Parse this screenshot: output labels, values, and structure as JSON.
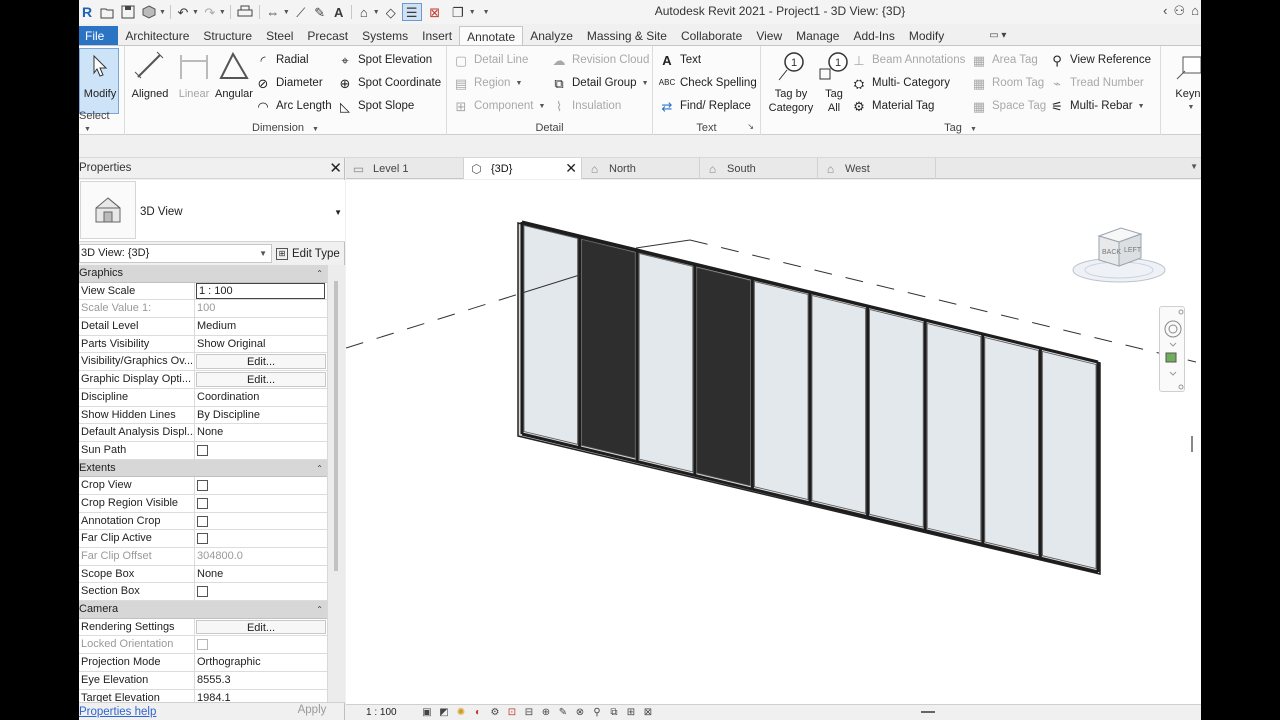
{
  "window": {
    "title": "Autodesk Revit 2021 - Project1 - 3D View: {3D}"
  },
  "menu": {
    "file": "File",
    "tabs": [
      "Architecture",
      "Structure",
      "Steel",
      "Precast",
      "Systems",
      "Insert",
      "Annotate",
      "Analyze",
      "Massing & Site",
      "Collaborate",
      "View",
      "Manage",
      "Add-Ins",
      "Modify"
    ],
    "active_tab": "Annotate"
  },
  "ribbon": {
    "select": {
      "modify": "Modify",
      "label": "Select"
    },
    "dimension": {
      "label": "Dimension",
      "aligned": "Aligned",
      "linear": "Linear",
      "angular": "Angular",
      "radial": "Radial",
      "diameter": "Diameter",
      "arc_length": "Arc Length",
      "spot_elevation": "Spot Elevation",
      "spot_coordinate": "Spot Coordinate",
      "spot_slope": "Spot Slope"
    },
    "detail": {
      "label": "Detail",
      "detail_line": "Detail Line",
      "region": "Region",
      "component": "Component",
      "revision_cloud": "Revision Cloud",
      "detail_group": "Detail Group",
      "insulation": "Insulation"
    },
    "text": {
      "label": "Text",
      "text": "Text",
      "check_spelling": "Check Spelling",
      "find_replace": "Find/ Replace"
    },
    "tag": {
      "label": "Tag",
      "tag_by_category_1": "Tag by",
      "tag_by_category_2": "Category",
      "tag_all_1": "Tag",
      "tag_all_2": "All",
      "beam_annotations": "Beam Annotations",
      "multi_category": "Multi- Category",
      "material_tag": "Material Tag",
      "area_tag": "Area Tag",
      "room_tag": "Room Tag",
      "space_tag": "Space Tag",
      "view_reference": "View Reference",
      "tread_number": "Tread Number",
      "multi_rebar": "Multi- Rebar"
    },
    "keynote": "Keyno"
  },
  "properties": {
    "title": "Properties",
    "type_name": "3D View",
    "instance": "3D View: {3D}",
    "edit_type": "Edit Type",
    "groups": [
      {
        "name": "Graphics",
        "rows": [
          {
            "name": "View Scale",
            "value": "1 : 100",
            "kind": "boxed"
          },
          {
            "name": "Scale Value    1:",
            "value": "100",
            "kind": "readonly"
          },
          {
            "name": "Detail Level",
            "value": "Medium",
            "kind": "text"
          },
          {
            "name": "Parts Visibility",
            "value": "Show Original",
            "kind": "text"
          },
          {
            "name": "Visibility/Graphics Ov...",
            "value": "Edit...",
            "kind": "button"
          },
          {
            "name": "Graphic Display Opti...",
            "value": "Edit...",
            "kind": "button"
          },
          {
            "name": "Discipline",
            "value": "Coordination",
            "kind": "text"
          },
          {
            "name": "Show Hidden Lines",
            "value": "By Discipline",
            "kind": "text"
          },
          {
            "name": "Default Analysis Displ...",
            "value": "None",
            "kind": "text"
          },
          {
            "name": "Sun Path",
            "value": "",
            "kind": "check"
          }
        ]
      },
      {
        "name": "Extents",
        "rows": [
          {
            "name": "Crop View",
            "value": "",
            "kind": "check"
          },
          {
            "name": "Crop Region Visible",
            "value": "",
            "kind": "check"
          },
          {
            "name": "Annotation Crop",
            "value": "",
            "kind": "check"
          },
          {
            "name": "Far Clip Active",
            "value": "",
            "kind": "check"
          },
          {
            "name": "Far Clip Offset",
            "value": "304800.0",
            "kind": "readonly"
          },
          {
            "name": "Scope Box",
            "value": "None",
            "kind": "text"
          },
          {
            "name": "Section Box",
            "value": "",
            "kind": "check"
          }
        ]
      },
      {
        "name": "Camera",
        "rows": [
          {
            "name": "Rendering Settings",
            "value": "Edit...",
            "kind": "button"
          },
          {
            "name": "Locked Orientation",
            "value": "",
            "kind": "check-readonly"
          },
          {
            "name": "Projection Mode",
            "value": "Orthographic",
            "kind": "text"
          },
          {
            "name": "Eye Elevation",
            "value": "8555.3",
            "kind": "text"
          },
          {
            "name": "Target Elevation",
            "value": "1984.1",
            "kind": "text"
          }
        ]
      }
    ],
    "help": "Properties help",
    "apply": "Apply"
  },
  "view_tabs": [
    {
      "label": "Level 1",
      "icon": "floor-plan-icon",
      "active": false
    },
    {
      "label": "{3D}",
      "icon": "3d-view-icon",
      "active": true
    },
    {
      "label": "North",
      "icon": "elevation-icon",
      "active": false
    },
    {
      "label": "South",
      "icon": "elevation-icon",
      "active": false
    },
    {
      "label": "West",
      "icon": "elevation-icon",
      "active": false
    }
  ],
  "viewcube": {
    "back": "BACK",
    "left": "LEFT"
  },
  "view_bar": {
    "scale": "1 : 100"
  },
  "curtain_wall": {
    "panels": [
      "glass",
      "dark",
      "glass",
      "dark",
      "glass",
      "glass",
      "glass",
      "glass",
      "glass",
      "glass"
    ]
  },
  "colors": {
    "file_tab": "#2b74c3",
    "glass_panel": "#e3e8ec",
    "dark_panel": "#2e2e2e",
    "selection": "#cde3f8"
  }
}
